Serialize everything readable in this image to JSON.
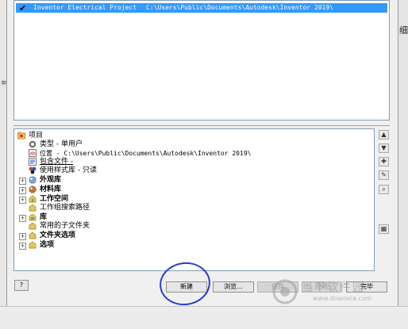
{
  "background": {
    "right_char": "细"
  },
  "project_list": {
    "selected_project": {
      "checked": true,
      "name": "Inventor Electrical Project",
      "path": "C:\\Users\\Public\\Documents\\Autodesk\\Inventor 2019\\"
    }
  },
  "tree": {
    "root": "项目",
    "rows": [
      {
        "label": "类型 - 单用户",
        "icon": "project-type-icon"
      },
      {
        "label": "位置 - C:\\Users\\Public\\Documents\\Autodesk\\Inventor 2019\\",
        "icon": "location-icon"
      },
      {
        "label": "包含文件 -",
        "icon": "include-file-icon"
      },
      {
        "label": "使用样式库 - 只读",
        "icon": "style-library-icon"
      },
      {
        "label": "外观库",
        "icon": "appearance-library-icon"
      },
      {
        "label": "材料库",
        "icon": "material-library-icon"
      },
      {
        "label": "工作空间",
        "icon": "workspace-icon"
      },
      {
        "label": "工作组搜索路径",
        "icon": "workgroup-path-icon"
      },
      {
        "label": "库",
        "icon": "library-icon"
      },
      {
        "label": "常用的子文件夹",
        "icon": "subfolder-icon"
      },
      {
        "label": "文件夹选项",
        "icon": "folder-options-icon"
      },
      {
        "label": "选项",
        "icon": "options-icon"
      }
    ]
  },
  "buttons": {
    "help": "?",
    "new": "新建",
    "browse": "浏览...",
    "save": "保存",
    "apply": "应用",
    "done": "完毕"
  },
  "watermark": {
    "brand": "当下软件园",
    "url": "www.downxia.com"
  },
  "colors": {
    "selection": "#3399ff",
    "annotation": "#2a3bd6"
  }
}
